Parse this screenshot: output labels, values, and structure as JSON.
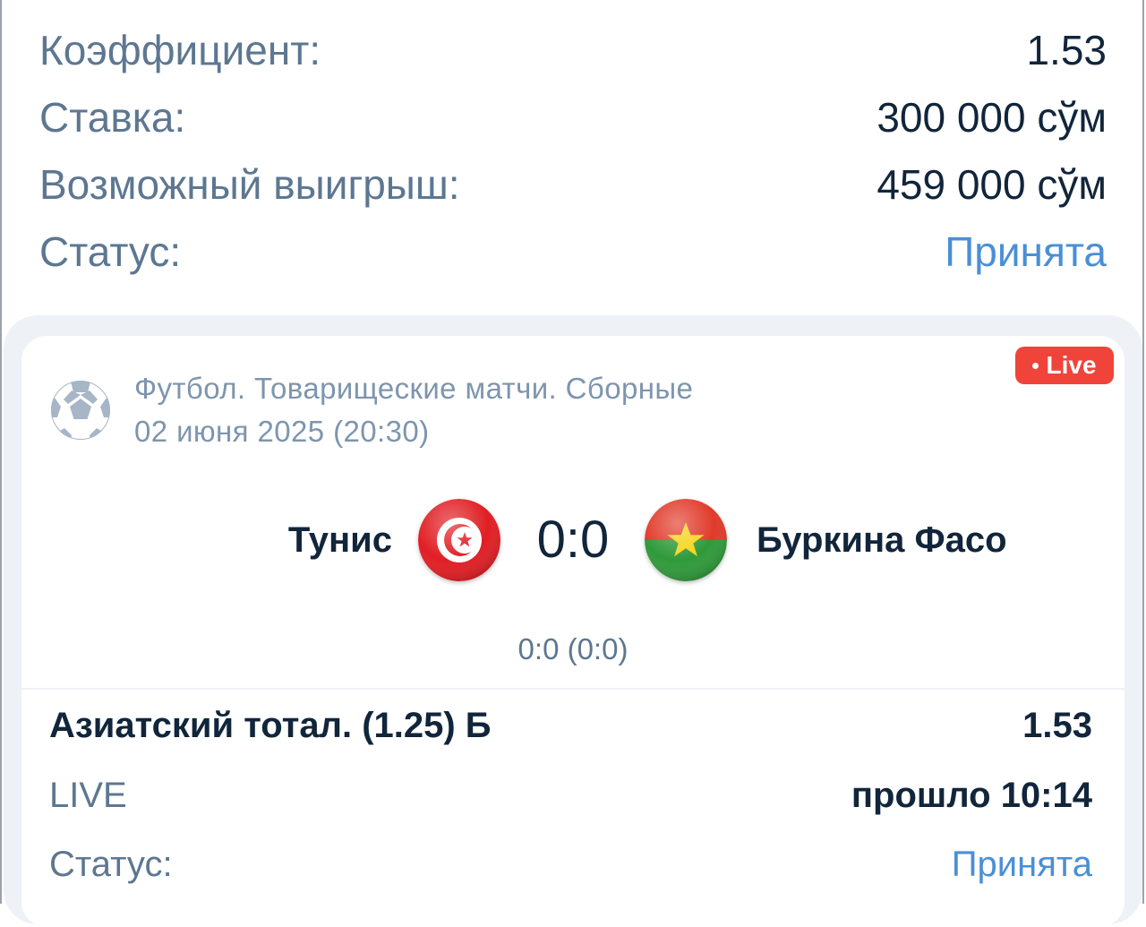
{
  "summary": {
    "odds_label": "Коэффициент:",
    "odds_value": "1.53",
    "stake_label": "Ставка:",
    "stake_value": "300 000 сўм",
    "win_label": "Возможный выигрыш:",
    "win_value": "459 000 сўм",
    "status_label": "Статус:",
    "status_value": "Принята"
  },
  "event": {
    "league": "Футбол. Товарищеские матчи. Сборные",
    "datetime": "02 июня 2025 (20:30)",
    "live_badge": "Live",
    "home_team": "Тунис",
    "away_team": "Буркина Фасо",
    "score": "0:0",
    "halftime": "0:0 (0:0)"
  },
  "bet": {
    "market": "Азиатский тотал. (1.25) Б",
    "odds": "1.53",
    "mode": "LIVE",
    "elapsed": "прошло 10:14",
    "status_label": "Статус:",
    "status_value": "Принята"
  },
  "colors": {
    "label": "#5d7791",
    "value": "#11253b",
    "status_accepted": "#4a8fd6",
    "live_badge": "#f0443a"
  },
  "icons": {
    "sport": "football-icon",
    "home_flag": "tunisia-flag-icon",
    "away_flag": "burkina-faso-flag-icon"
  }
}
